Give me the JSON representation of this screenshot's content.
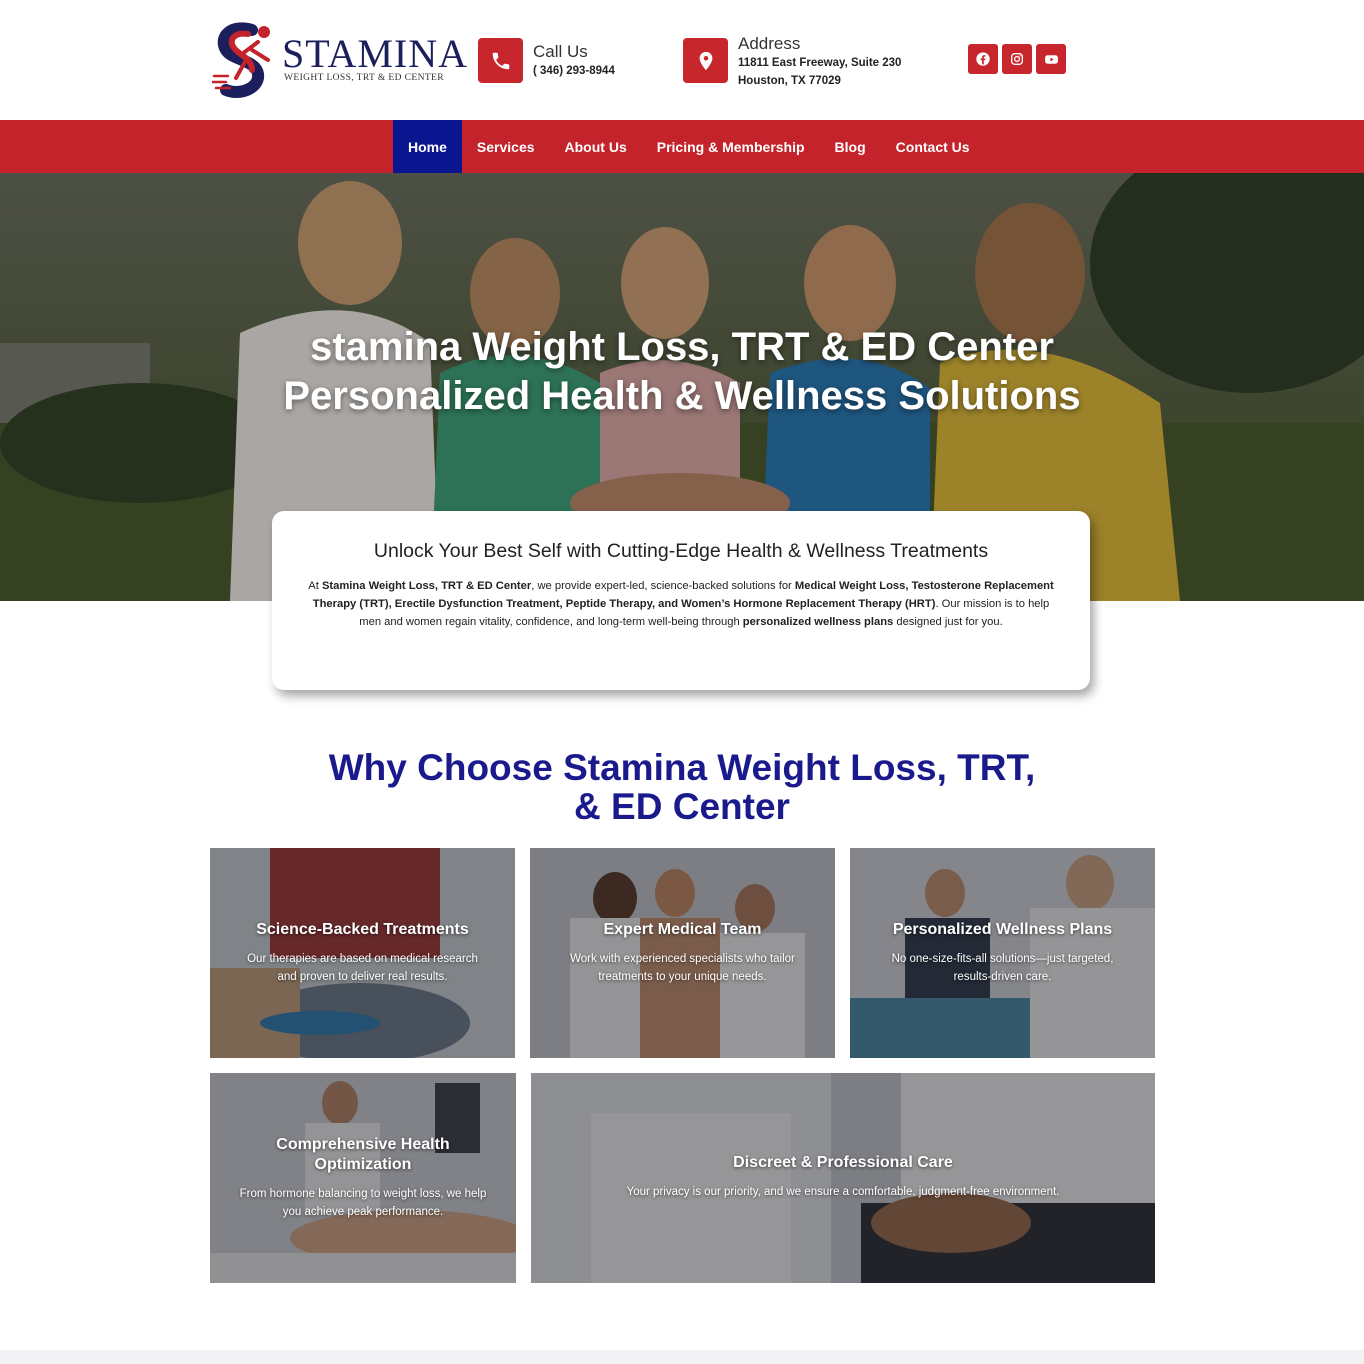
{
  "brand": {
    "name": "STAMINA",
    "tagline": "WEIGHT LOSS, TRT & ED CENTER",
    "colors": {
      "red": "#c4232b",
      "navy": "#0a1690",
      "heading_blue": "#1a1a8c"
    }
  },
  "header": {
    "call": {
      "label": "Call Us",
      "value": "( 346) 293-8944",
      "icon": "phone-icon"
    },
    "address": {
      "label": "Address",
      "line1": "11811 East Freeway, Suite 230",
      "line2": "Houston, TX 77029",
      "icon": "map-pin-icon"
    },
    "socials": [
      "facebook-icon",
      "instagram-icon",
      "youtube-icon"
    ]
  },
  "nav": {
    "items": [
      {
        "label": "Home",
        "active": true
      },
      {
        "label": "Services"
      },
      {
        "label": "About Us"
      },
      {
        "label": "Pricing & Membership"
      },
      {
        "label": "Blog"
      },
      {
        "label": "Contact Us"
      }
    ]
  },
  "hero": {
    "title_line1": "stamina Weight Loss, TRT & ED Center",
    "title_line2": "Personalized Health & Wellness Solutions"
  },
  "intro": {
    "heading": "Unlock Your Best Self with Cutting-Edge Health & Wellness Treatments",
    "p1": "At ",
    "b1": "Stamina Weight Loss, TRT & ED Center",
    "p2": ", we provide expert-led, science-backed solutions for ",
    "b2": "Medical Weight Loss, Testosterone Replacement Therapy (TRT), Erectile Dysfunction Treatment, Peptide Therapy, and Women’s Hormone Replacement Therapy (HRT)",
    "p3": ". Our mission is to help men and women regain vitality, confidence, and long-term well-being through ",
    "b3": "personalized wellness plans",
    "p4": " designed just for you."
  },
  "why": {
    "title_line1": "Why Choose Stamina Weight Loss, TRT,",
    "title_line2": "& ED Center",
    "tiles": [
      {
        "title": "Science-Backed Treatments",
        "desc": "Our therapies are based on medical research and proven to deliver real results."
      },
      {
        "title": "Expert Medical Team",
        "desc": "Work with experienced specialists who tailor treatments to your unique needs."
      },
      {
        "title": "Personalized Wellness Plans",
        "desc": "No one-size-fits-all solutions—just targeted, results-driven care."
      },
      {
        "title": "Comprehensive Health Optimization",
        "desc": "From hormone balancing to weight loss, we help you achieve peak performance."
      },
      {
        "title": "Discreet & Professional Care",
        "desc": "Your privacy is our priority, and we ensure a comfortable, judgment-free environment."
      }
    ]
  }
}
